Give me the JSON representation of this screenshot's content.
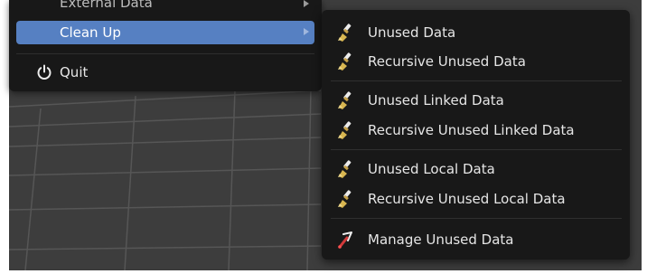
{
  "file_menu": {
    "items": [
      {
        "label": "External Data",
        "icon": "none",
        "has_submenu": true
      },
      {
        "label": "Clean Up",
        "icon": "none",
        "has_submenu": true,
        "highlighted": true
      },
      {
        "label": "Quit",
        "icon": "power-icon",
        "has_submenu": false
      }
    ]
  },
  "cleanup_submenu": {
    "items": [
      {
        "label": "Unused Data",
        "icon": "brush-icon"
      },
      {
        "label": "Recursive Unused Data",
        "icon": "brush-icon"
      },
      {
        "label": "Unused Linked Data",
        "icon": "brush-icon"
      },
      {
        "label": "Recursive Unused Linked Data",
        "icon": "brush-icon"
      },
      {
        "label": "Unused Local Data",
        "icon": "brush-icon"
      },
      {
        "label": "Recursive Unused Local Data",
        "icon": "brush-icon"
      },
      {
        "label": "Manage Unused Data",
        "icon": "orphan-cleanup-icon"
      }
    ]
  },
  "colors": {
    "menu_background": "#181818",
    "highlight": "#5680c2",
    "viewport_background": "#3d3d3d",
    "grid_line": "#555555",
    "text": "#e6e6e6"
  }
}
